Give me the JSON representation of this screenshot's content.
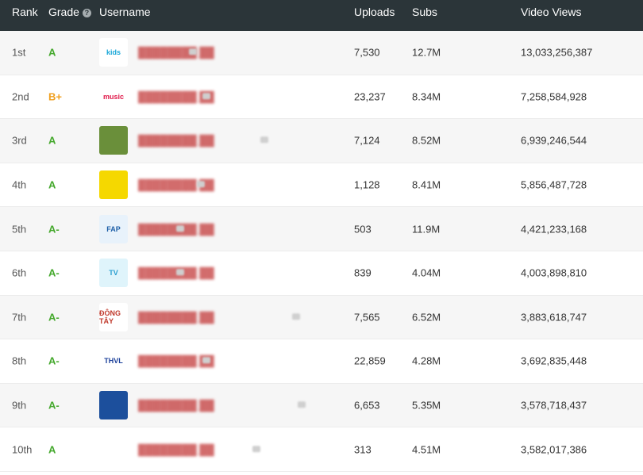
{
  "headers": {
    "rank": "Rank",
    "grade": "Grade",
    "grade_help_icon": "question-icon",
    "username": "Username",
    "uploads": "Uploads",
    "subs": "Subs",
    "views": "Video Views"
  },
  "rows": [
    {
      "rank": "1st",
      "grade": "A",
      "uploads": "7,530",
      "subs": "12.7M",
      "views": "13,033,256,387",
      "avatar_label": "kids",
      "avatar_bg": "#ffffff",
      "avatar_fg": "#1aa7d8"
    },
    {
      "rank": "2nd",
      "grade": "B+",
      "uploads": "23,237",
      "subs": "8.34M",
      "views": "7,258,584,928",
      "avatar_label": "music",
      "avatar_bg": "#ffffff",
      "avatar_fg": "#e0194a"
    },
    {
      "rank": "3rd",
      "grade": "A",
      "uploads": "7,124",
      "subs": "8.52M",
      "views": "6,939,246,544",
      "avatar_label": "",
      "avatar_bg": "#6a8f3a",
      "avatar_fg": "#ffffff"
    },
    {
      "rank": "4th",
      "grade": "A",
      "uploads": "1,128",
      "subs": "8.41M",
      "views": "5,856,487,728",
      "avatar_label": "",
      "avatar_bg": "#f5d800",
      "avatar_fg": "#222222"
    },
    {
      "rank": "5th",
      "grade": "A-",
      "uploads": "503",
      "subs": "11.9M",
      "views": "4,421,233,168",
      "avatar_label": "FAP",
      "avatar_bg": "#e8f2fb",
      "avatar_fg": "#1d5fa8"
    },
    {
      "rank": "6th",
      "grade": "A-",
      "uploads": "839",
      "subs": "4.04M",
      "views": "4,003,898,810",
      "avatar_label": "TV",
      "avatar_bg": "#dff4fb",
      "avatar_fg": "#2a9fd0"
    },
    {
      "rank": "7th",
      "grade": "A-",
      "uploads": "7,565",
      "subs": "6.52M",
      "views": "3,883,618,747",
      "avatar_label": "ĐÔNG TÂY",
      "avatar_bg": "#ffffff",
      "avatar_fg": "#c0392b"
    },
    {
      "rank": "8th",
      "grade": "A-",
      "uploads": "22,859",
      "subs": "4.28M",
      "views": "3,692,835,448",
      "avatar_label": "THVL",
      "avatar_bg": "#ffffff",
      "avatar_fg": "#1a3f9a"
    },
    {
      "rank": "9th",
      "grade": "A-",
      "uploads": "6,653",
      "subs": "5.35M",
      "views": "3,578,718,437",
      "avatar_label": "",
      "avatar_bg": "#1c4f9c",
      "avatar_fg": "#ffd400"
    },
    {
      "rank": "10th",
      "grade": "A",
      "uploads": "313",
      "subs": "4.51M",
      "views": "3,582,017,386",
      "avatar_label": "",
      "avatar_bg": "#ffffff",
      "avatar_fg": "#3aa2d6"
    }
  ]
}
